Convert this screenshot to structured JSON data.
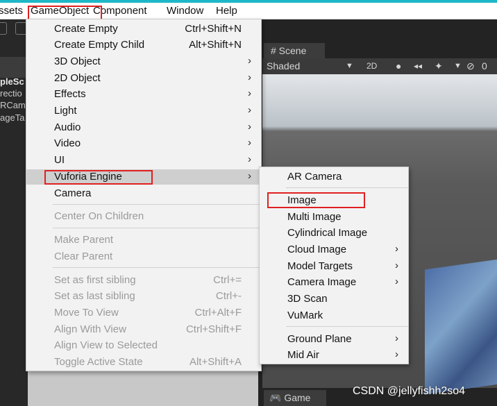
{
  "menubar": {
    "items": [
      "ssets",
      "GameObject",
      "Component",
      "Window",
      "Help"
    ]
  },
  "hierarchy": {
    "rows": [
      "pleSc",
      "rectio",
      "RCame",
      "ageTa"
    ]
  },
  "scene": {
    "tab_label": "# Scene",
    "shading_mode": "Shaded",
    "mode_2d": "2D",
    "hidden_count": "0"
  },
  "game": {
    "tab_label": "Game"
  },
  "gameobject_menu": {
    "items": [
      {
        "label": "Create Empty",
        "shortcut": "Ctrl+Shift+N"
      },
      {
        "label": "Create Empty Child",
        "shortcut": "Alt+Shift+N"
      },
      {
        "label": "3D Object",
        "submenu": true
      },
      {
        "label": "2D Object",
        "submenu": true
      },
      {
        "label": "Effects",
        "submenu": true
      },
      {
        "label": "Light",
        "submenu": true
      },
      {
        "label": "Audio",
        "submenu": true
      },
      {
        "label": "Video",
        "submenu": true
      },
      {
        "label": "UI",
        "submenu": true
      },
      {
        "label": "Vuforia Engine",
        "submenu": true
      },
      {
        "label": "Camera"
      },
      {
        "label": "Center On Children",
        "disabled": true
      },
      {
        "label": "Make Parent",
        "disabled": true
      },
      {
        "label": "Clear Parent",
        "disabled": true
      },
      {
        "label": "Set as first sibling",
        "shortcut": "Ctrl+=",
        "disabled": true
      },
      {
        "label": "Set as last sibling",
        "shortcut": "Ctrl+-",
        "disabled": true
      },
      {
        "label": "Move To View",
        "shortcut": "Ctrl+Alt+F",
        "disabled": true
      },
      {
        "label": "Align With View",
        "shortcut": "Ctrl+Shift+F",
        "disabled": true
      },
      {
        "label": "Align View to Selected",
        "disabled": true
      },
      {
        "label": "Toggle Active State",
        "shortcut": "Alt+Shift+A",
        "disabled": true
      }
    ]
  },
  "vuforia_submenu": {
    "items": [
      {
        "label": "AR Camera"
      },
      {
        "label": "Image"
      },
      {
        "label": "Multi Image"
      },
      {
        "label": "Cylindrical Image"
      },
      {
        "label": "Cloud Image",
        "submenu": true
      },
      {
        "label": "Model Targets",
        "submenu": true
      },
      {
        "label": "Camera Image",
        "submenu": true
      },
      {
        "label": "3D Scan"
      },
      {
        "label": "VuMark"
      },
      {
        "label": "Ground Plane",
        "submenu": true
      },
      {
        "label": "Mid Air",
        "submenu": true
      }
    ]
  },
  "submenu_arrow": "›",
  "watermark": "CSDN @jellyfishh2so4",
  "colors": {
    "highlight_box": "#e02020",
    "title_accent": "#1fb7c7"
  }
}
